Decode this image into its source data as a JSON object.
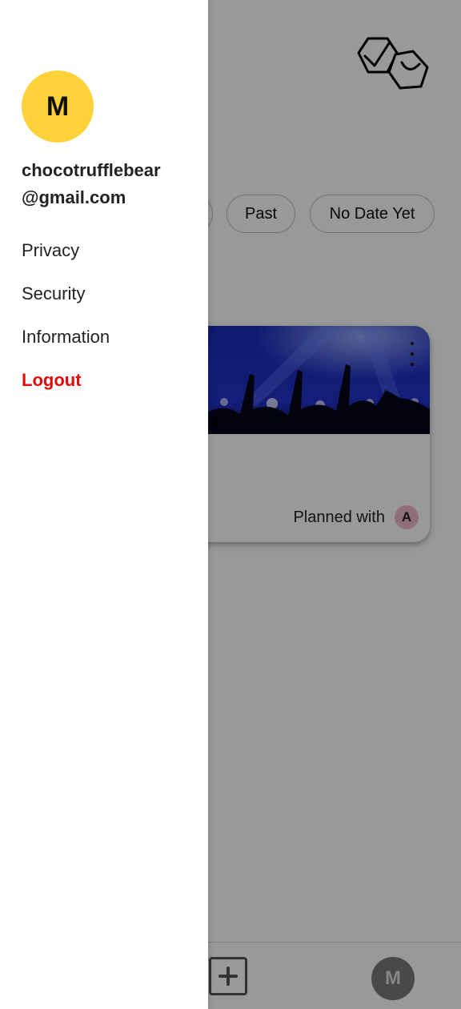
{
  "filters": {
    "chips": [
      "Past",
      "No Date Yet"
    ]
  },
  "event_card": {
    "planned_label": "Planned with",
    "participant_initial": "A"
  },
  "bottom_nav": {
    "avatar_initial": "M"
  },
  "drawer": {
    "avatar_initial": "M",
    "email_line1": "chocotrufflebear",
    "email_line2": "@gmail.com",
    "menu": [
      {
        "label": "Privacy"
      },
      {
        "label": "Security"
      },
      {
        "label": "Information"
      },
      {
        "label": "Logout"
      }
    ]
  },
  "colors": {
    "drawer_avatar": "#fdd23a",
    "logout": "#e20a0a",
    "participant_avatar": "#f0b9c8",
    "overlay": "rgba(0,0,0,0.4)"
  },
  "icons": {
    "logo": "hexagon-pair-logo-icon",
    "more": "more-vertical-icon",
    "add": "add-square-icon"
  }
}
